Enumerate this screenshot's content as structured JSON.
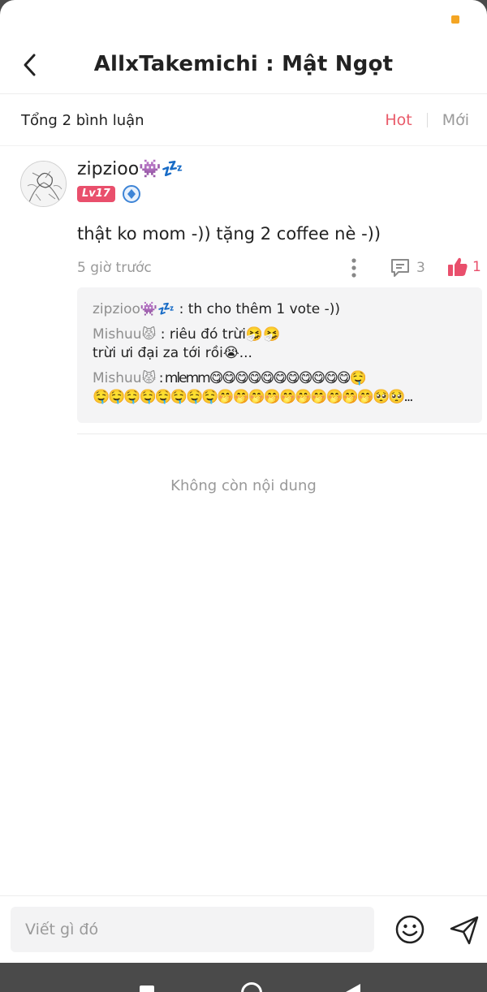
{
  "header": {
    "title": "AllxTakemichi : Mật Ngọt",
    "back_icon": "chevron-left-icon"
  },
  "subbar": {
    "total": "Tổng 2 bình luận",
    "sort_hot": "Hot",
    "sort_new": "Mới"
  },
  "comment": {
    "username": "zipzioo👾💤",
    "level": "Lv17",
    "text": "thật ko mom -)) tặng 2 coffee nè -))",
    "time": "5 giờ trước",
    "reply_count": "3",
    "like_count": "1",
    "replies": [
      {
        "name": "zipzioo👾💤",
        "text": " : th cho thêm 1 vote -))"
      },
      {
        "name": "Mishuu😾",
        "text": " : riêu đó trừi🤧🤧",
        "line2": "trừi ưi đại za tới rồi😭..."
      },
      {
        "name": "Mishuu😾",
        "text": " : mlemm😋😋😋😋😋😋😋😋😋😋😋🤤",
        "line2": "🤤🤤🤤🤤🤤🤤🤤🤤🤭🤭🤭🤭🤭🤭🤭🤭🤭🤭🥺🥺..."
      }
    ]
  },
  "end_text": "Không còn nội dung",
  "input": {
    "placeholder": "Viết gì đó"
  },
  "colors": {
    "accent": "#e94f6c",
    "hot": "#e95b6a",
    "muted": "#999999"
  }
}
